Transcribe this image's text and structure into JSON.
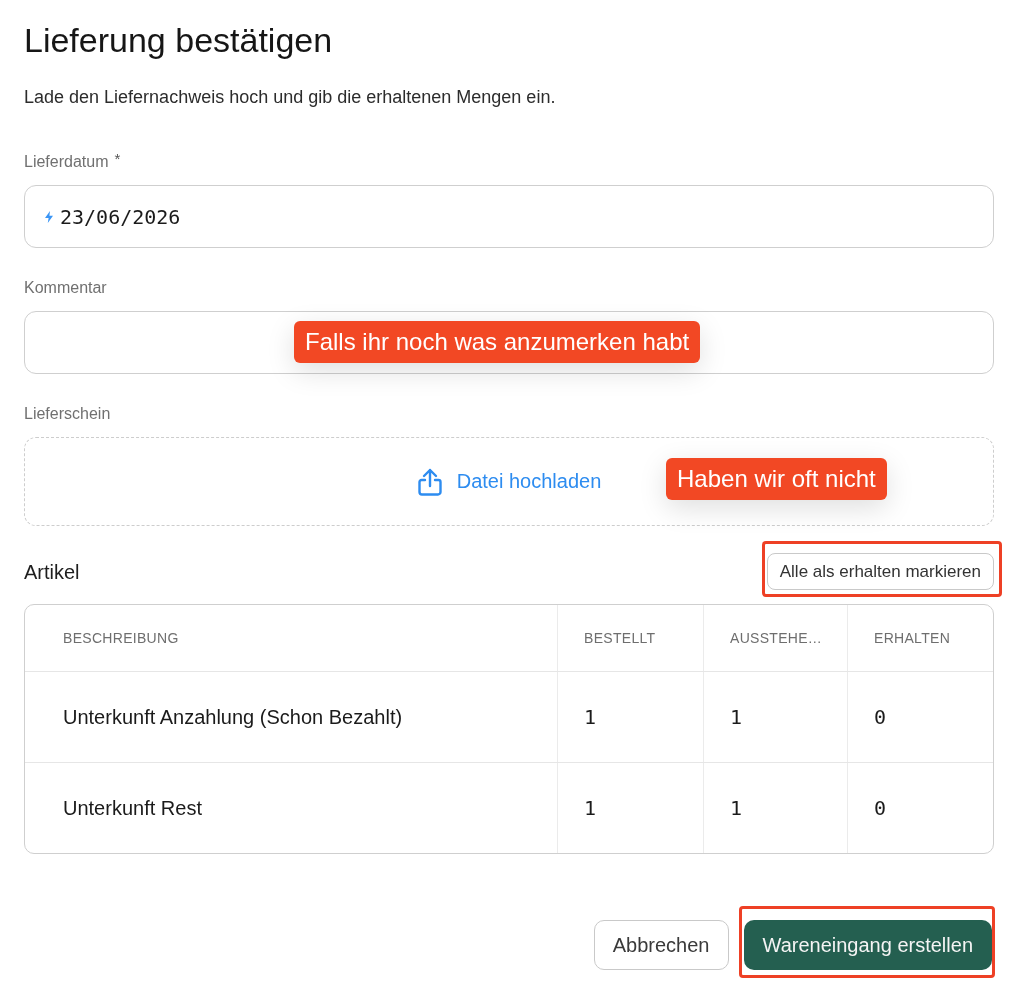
{
  "dialog": {
    "title": "Lieferung bestätigen",
    "subtitle": "Lade den Liefernachweis hoch und gib die erhaltenen Mengen ein."
  },
  "fields": [
    {
      "kind": "date",
      "label": "Lieferdatum",
      "required_mark": "*",
      "value": "23/06/2026"
    },
    {
      "kind": "text",
      "label": "Kommentar",
      "callout": "Falls ihr noch was anzumerken habt"
    },
    {
      "kind": "upload",
      "label": "Lieferschein",
      "action": "Datei hochladen",
      "callout": "Haben wir oft nicht"
    }
  ],
  "items": {
    "title": "Artikel",
    "action": {
      "label": "Alle als erhalten markieren",
      "highlighted": true
    },
    "table": {
      "columns": [
        "BESCHREIBUNG",
        "BESTELLT",
        "AUSSTEHE…",
        "ERHALTEN"
      ],
      "rows": [
        [
          "Unterkunft Anzahlung (Schon Bezahlt)",
          "1",
          "1",
          "0"
        ],
        [
          "Unterkunft Rest",
          "1",
          "1",
          "0"
        ]
      ]
    }
  },
  "footer": {
    "buttons": [
      {
        "kind": "secondary",
        "label": "Abbrechen",
        "highlighted": false
      },
      {
        "kind": "primary",
        "label": "Wareneingang erstellen",
        "highlighted": true
      }
    ]
  }
}
